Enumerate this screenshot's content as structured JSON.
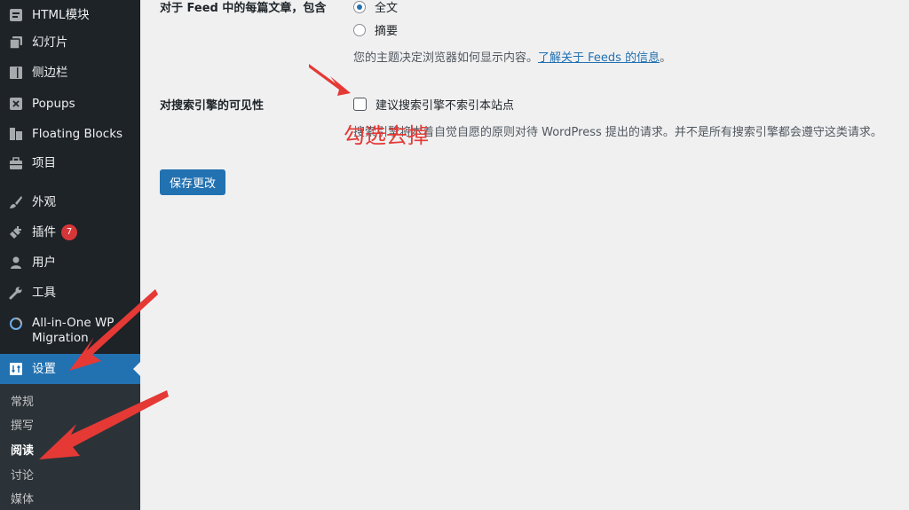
{
  "sidebar": {
    "items": [
      {
        "icon": "html-block-icon",
        "label": "HTML模块"
      },
      {
        "icon": "slides-icon",
        "label": "幻灯片"
      },
      {
        "icon": "sidebar-icon",
        "label": "侧边栏"
      },
      {
        "icon": "popups-icon",
        "label": "Popups"
      },
      {
        "icon": "floating-blocks-icon",
        "label": "Floating Blocks"
      },
      {
        "icon": "briefcase-icon",
        "label": "项目"
      },
      {
        "icon": "appearance-brush-icon",
        "label": "外观"
      },
      {
        "icon": "plugin-icon",
        "label": "插件",
        "badge": "7"
      },
      {
        "icon": "user-icon",
        "label": "用户"
      },
      {
        "icon": "wrench-icon",
        "label": "工具"
      },
      {
        "icon": "migration-icon",
        "label": "All-in-One WP Migration"
      },
      {
        "icon": "settings-icon",
        "label": "设置",
        "current": true
      }
    ],
    "submenu": [
      {
        "label": "常规"
      },
      {
        "label": "撰写"
      },
      {
        "label": "阅读",
        "active": true
      },
      {
        "label": "讨论"
      },
      {
        "label": "媒体"
      }
    ]
  },
  "main": {
    "feed_row": {
      "label": "对于 Feed 中的每篇文章，包含",
      "options": [
        {
          "label": "全文",
          "checked": true
        },
        {
          "label": "摘要",
          "checked": false
        }
      ],
      "description": "您的主题决定浏览器如何显示内容。",
      "link": "了解关于 Feeds 的信息",
      "suffix": "。"
    },
    "search_row": {
      "label": "对搜索引擎的可见性",
      "checkbox_label": "建议搜索引擎不索引本站点",
      "description": "搜索引擎将本着自觉自愿的原则对待 WordPress 提出的请求。并不是所有搜索引擎都会遵守这类请求。"
    },
    "save_button": "保存更改"
  },
  "annotation": {
    "text": "勾选去掉",
    "color": "#e53935"
  },
  "colors": {
    "sidebar_bg": "#1d2327",
    "accent": "#2271b1",
    "badge": "#d63638",
    "annotation": "#e53935"
  }
}
